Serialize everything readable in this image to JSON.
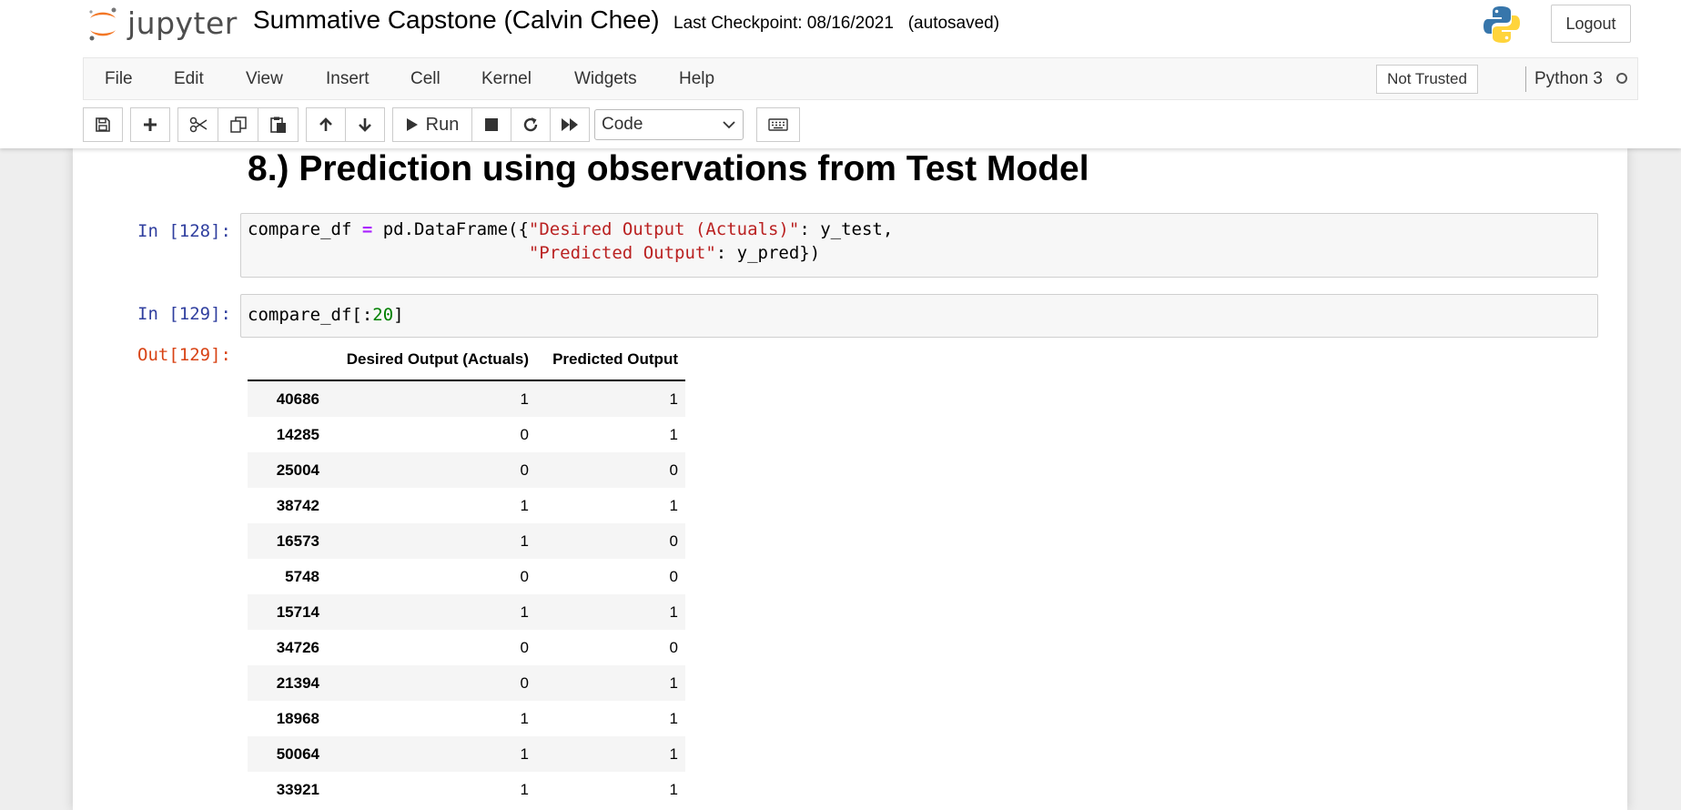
{
  "header": {
    "logo_text": "jupyter",
    "notebook_title": "Summative Capstone (Calvin Chee)",
    "checkpoint": "Last Checkpoint: 08/16/2021   (autosaved)",
    "logout_label": "Logout"
  },
  "menubar": {
    "items": [
      "File",
      "Edit",
      "View",
      "Insert",
      "Cell",
      "Kernel",
      "Widgets",
      "Help"
    ],
    "trust_label": "Not Trusted",
    "kernel_name": "Python 3"
  },
  "toolbar": {
    "run_label": "Run",
    "cell_type": "Code",
    "icons": [
      "save-icon",
      "plus-icon",
      "cut-icon",
      "copy-icon",
      "paste-icon",
      "arrow-up-icon",
      "arrow-down-icon",
      "play-icon",
      "stop-icon",
      "restart-icon",
      "fast-forward-icon",
      "keyboard-icon"
    ]
  },
  "notebook": {
    "heading": "8.) Prediction using observations from Test Model",
    "cell1": {
      "prompt": "In [128]:",
      "code_line1_a": "compare_df ",
      "code_line1_op": "=",
      "code_line1_b": " pd.DataFrame({",
      "code_line1_str": "\"Desired Output (Actuals)\"",
      "code_line1_c": ": y_test,",
      "code_line2_indent": "                           ",
      "code_line2_str": "\"Predicted Output\"",
      "code_line2_c": ": y_pred})"
    },
    "cell2": {
      "prompt": "In [129]:",
      "code_a": "compare_df[:",
      "code_num": "20",
      "code_b": "]",
      "out_prompt": "Out[129]:"
    },
    "dataframe": {
      "columns": [
        "",
        "Desired Output (Actuals)",
        "Predicted Output"
      ],
      "rows": [
        [
          "40686",
          "1",
          "1"
        ],
        [
          "14285",
          "0",
          "1"
        ],
        [
          "25004",
          "0",
          "0"
        ],
        [
          "38742",
          "1",
          "1"
        ],
        [
          "16573",
          "1",
          "0"
        ],
        [
          "5748",
          "0",
          "0"
        ],
        [
          "15714",
          "1",
          "1"
        ],
        [
          "34726",
          "0",
          "0"
        ],
        [
          "21394",
          "0",
          "1"
        ],
        [
          "18968",
          "1",
          "1"
        ],
        [
          "50064",
          "1",
          "1"
        ],
        [
          "33921",
          "1",
          "1"
        ]
      ]
    }
  }
}
